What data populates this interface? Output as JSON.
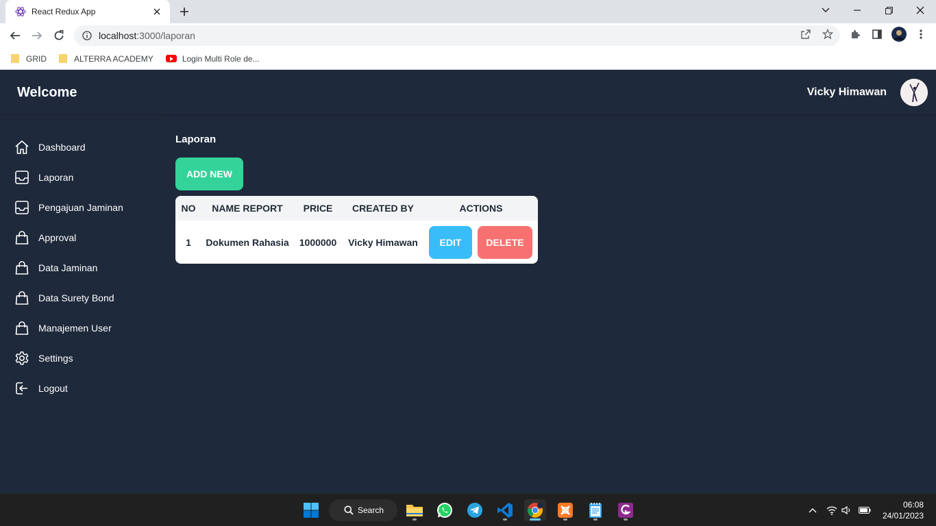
{
  "browser": {
    "tab_title": "React Redux App",
    "url_host": "localhost",
    "url_path": ":3000/laporan",
    "bookmarks": [
      {
        "label": "GRID",
        "icon": "folder-icon"
      },
      {
        "label": "ALTERRA ACADEMY",
        "icon": "folder-icon"
      },
      {
        "label": "Login Multi Role de...",
        "icon": "youtube-icon"
      }
    ]
  },
  "header": {
    "title": "Welcome",
    "user_name": "Vicky Himawan"
  },
  "sidebar": {
    "items": [
      {
        "label": "Dashboard",
        "icon": "home-icon"
      },
      {
        "label": "Laporan",
        "icon": "inbox-icon"
      },
      {
        "label": "Pengajuan Jaminan",
        "icon": "inbox-icon"
      },
      {
        "label": "Approval",
        "icon": "shopping-bag-icon"
      },
      {
        "label": "Data Jaminan",
        "icon": "shopping-bag-icon"
      },
      {
        "label": "Data Surety Bond",
        "icon": "shopping-bag-icon"
      },
      {
        "label": "Manajemen User",
        "icon": "shopping-bag-icon"
      },
      {
        "label": "Settings",
        "icon": "gear-icon"
      },
      {
        "label": "Logout",
        "icon": "logout-icon"
      }
    ]
  },
  "main": {
    "title": "Laporan",
    "add_button": "ADD NEW",
    "table": {
      "headers": [
        "NO",
        "NAME REPORT",
        "PRICE",
        "CREATED BY",
        "ACTIONS"
      ],
      "rows": [
        {
          "no": "1",
          "name": "Dokumen Rahasia",
          "price": "1000000",
          "created_by": "Vicky Himawan",
          "edit": "EDIT",
          "delete": "DELETE"
        }
      ]
    }
  },
  "taskbar": {
    "search_label": "Search",
    "time": "06:08",
    "date": "24/01/2023"
  },
  "colors": {
    "app_bg": "#1e293b",
    "add_button": "#34d399",
    "edit_button": "#38bdf8",
    "delete_button": "#f87171"
  }
}
